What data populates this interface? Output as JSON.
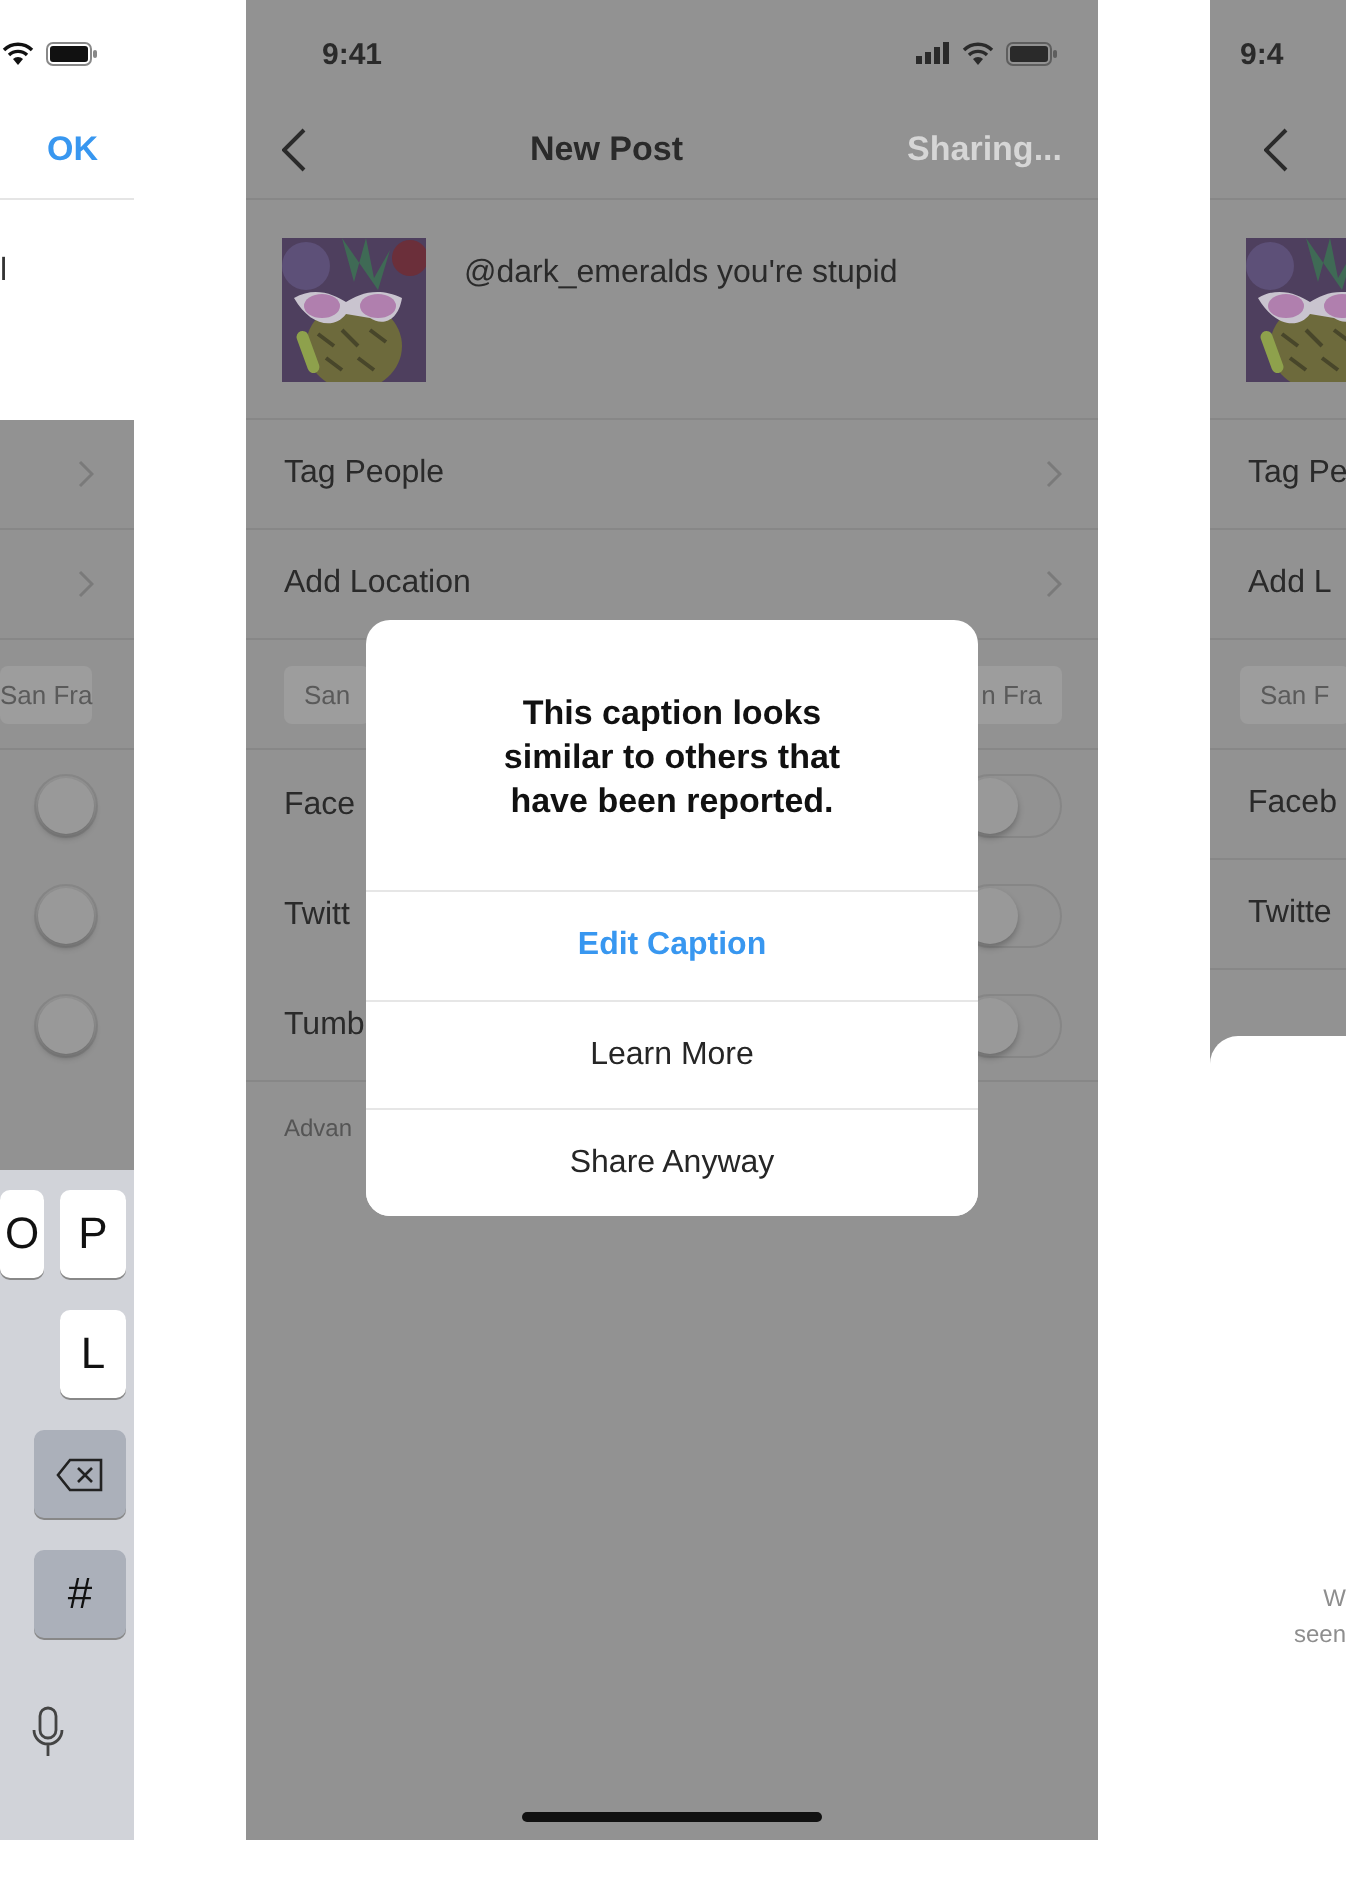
{
  "left_screen": {
    "nav_action": "OK",
    "text_fragment": "l",
    "rows": [
      {
        "kind": "chevron"
      },
      {
        "kind": "chevron"
      },
      {
        "kind": "chip",
        "label": "San Fra"
      },
      {
        "kind": "toggle",
        "on": false
      },
      {
        "kind": "toggle",
        "on": false
      },
      {
        "kind": "toggle",
        "on": false
      }
    ],
    "keyboard": [
      [
        {
          "kind": "letter",
          "label": "O"
        },
        {
          "kind": "letter",
          "label": "P"
        }
      ],
      [
        {
          "kind": "letter",
          "label": "L"
        }
      ],
      [
        {
          "kind": "delete"
        }
      ],
      [
        {
          "kind": "symbol",
          "label": "#"
        }
      ],
      [
        {
          "kind": "mic"
        }
      ]
    ]
  },
  "middle_screen": {
    "time": "9:41",
    "title": "New Post",
    "nav_action": "Sharing...",
    "caption": "@dark_emeralds you're stupid",
    "rows": [
      {
        "kind": "link",
        "label": "Tag People"
      },
      {
        "kind": "link",
        "label": "Add Location"
      },
      {
        "kind": "chips",
        "chips": [
          "San",
          "n Fra"
        ]
      },
      {
        "kind": "toggle",
        "label": "Face",
        "on": false
      },
      {
        "kind": "toggle",
        "label": "Twitt",
        "on": false
      },
      {
        "kind": "toggle",
        "label": "Tumb",
        "on": false
      },
      {
        "kind": "note",
        "label": "Advan"
      }
    ],
    "dialog": {
      "message": "This caption looks similar to others that have been reported.",
      "actions": [
        {
          "label": "Edit Caption",
          "primary": true
        },
        {
          "label": "Learn More",
          "primary": false
        },
        {
          "label": "Share Anyway",
          "primary": false
        }
      ]
    }
  },
  "right_screen": {
    "time": "9:4",
    "rows": [
      {
        "kind": "link",
        "label": "Tag Pe"
      },
      {
        "kind": "link",
        "label": "Add L"
      },
      {
        "kind": "chip",
        "label": "San F"
      },
      {
        "kind": "link",
        "label": "Faceb"
      },
      {
        "kind": "link",
        "label": "Twitte"
      }
    ],
    "sheet_lines": [
      "W",
      "seen"
    ]
  }
}
